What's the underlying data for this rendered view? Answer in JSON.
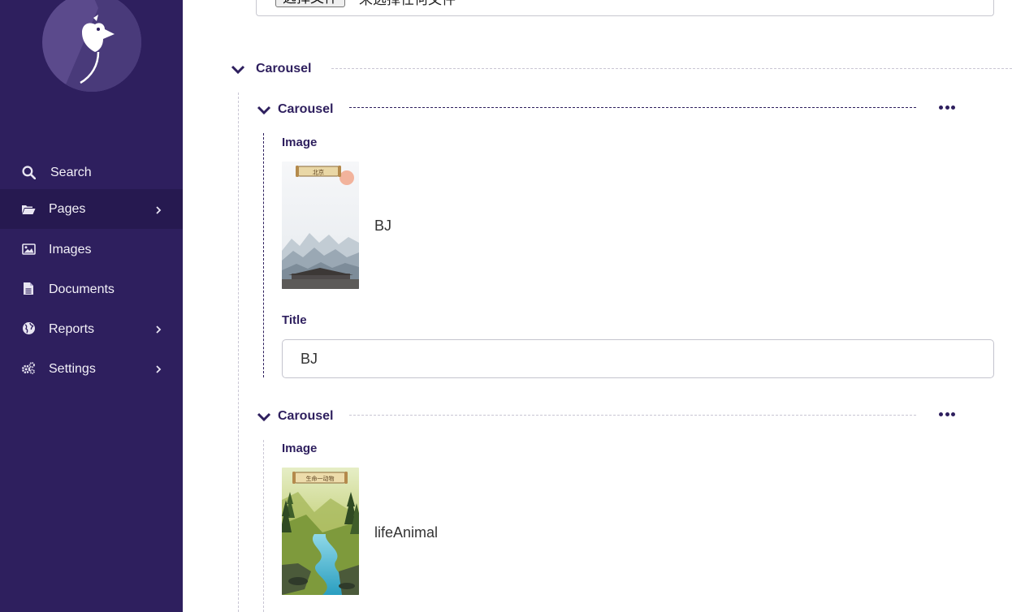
{
  "sidebar": {
    "logo_icon": "wagtail-bird-logo",
    "items": [
      {
        "label": "Search",
        "icon": "search-icon",
        "chevron": false
      },
      {
        "label": "Pages",
        "icon": "folder-open-icon",
        "chevron": true,
        "active": true
      },
      {
        "label": "Images",
        "icon": "image-icon",
        "chevron": false
      },
      {
        "label": "Documents",
        "icon": "document-icon",
        "chevron": false
      },
      {
        "label": "Reports",
        "icon": "globe-icon",
        "chevron": true
      },
      {
        "label": "Settings",
        "icon": "cogs-icon",
        "chevron": true
      }
    ]
  },
  "file_input": {
    "button_label": "选择文件",
    "status_text": "未选择任何文件"
  },
  "carousel_block": {
    "title": "Carousel",
    "children": [
      {
        "title": "Carousel",
        "image_label": "Image",
        "image_title": "BJ",
        "image_caption": "北京",
        "title_label": "Title",
        "title_value": "BJ"
      },
      {
        "title": "Carousel",
        "image_label": "Image",
        "image_title": "lifeAnimal",
        "image_caption": "生命一动物"
      }
    ]
  },
  "colors": {
    "sidebar_bg": "#2e1f5e",
    "sidebar_active": "#261950",
    "accent": "#2e1f5e"
  }
}
